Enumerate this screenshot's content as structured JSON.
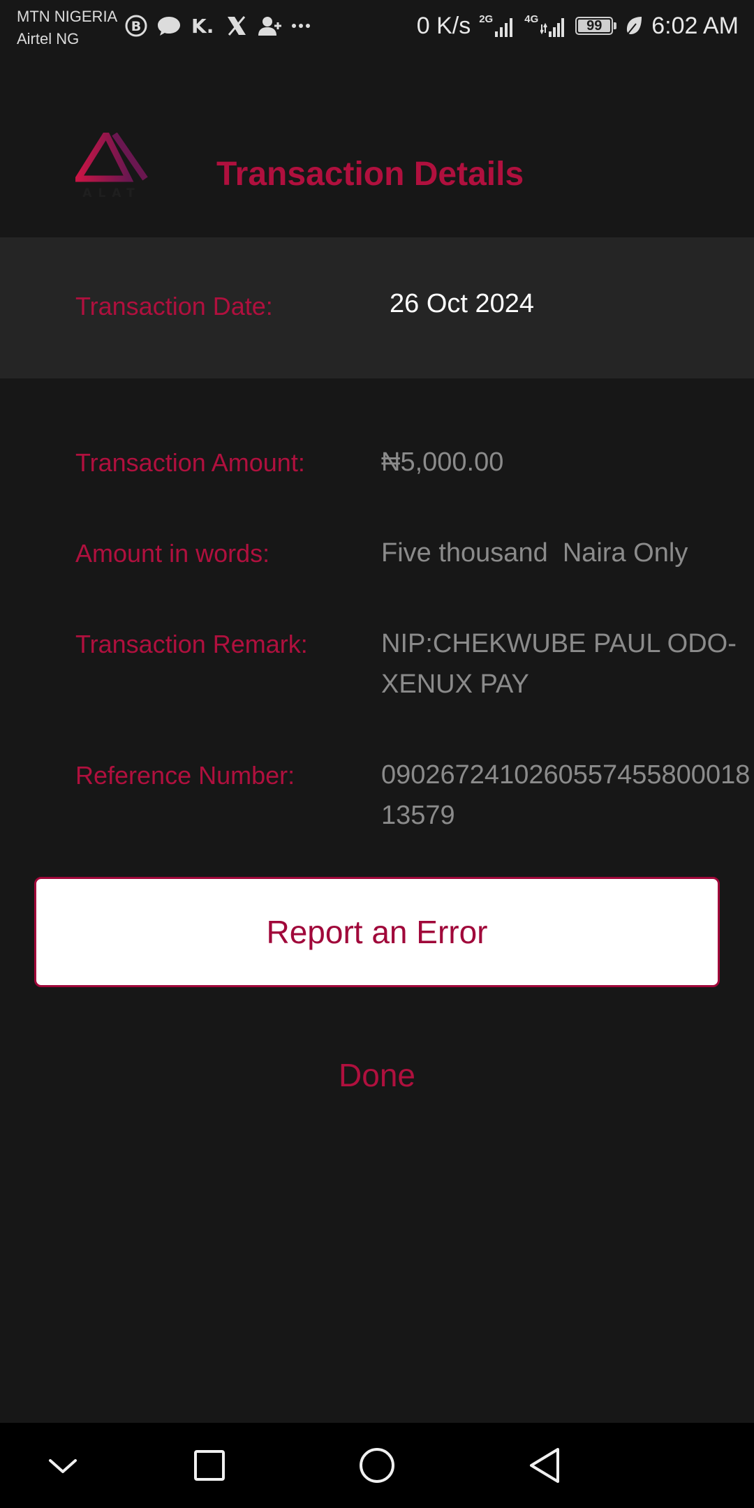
{
  "status_bar": {
    "carrier_1": "MTN NIGERIA",
    "carrier_2": "Airtel NG",
    "notification_icons": [
      "b-circle-icon",
      "chat-bubble-icon",
      "k-icon",
      "x-icon",
      "add-user-icon",
      "more-dots-icon"
    ],
    "net_speed": "0 K/s",
    "net_1": "2G",
    "net_2": "4G",
    "battery": "99",
    "battery_level": 0.99,
    "time": "6:02 AM"
  },
  "header": {
    "logo_text": "ALAT",
    "title": "Transaction Details"
  },
  "details": {
    "date_label": "Transaction Date:",
    "date_value": "26 Oct 2024",
    "amount_label": "Transaction Amount:",
    "amount_value": "₦5,000.00",
    "words_label": "Amount in words:",
    "words_value": "Five thousand  Naira Only",
    "remark_label": "Transaction Remark:",
    "remark_value": "NIP:CHEKWUBE PAUL ODO-XENUX PAY",
    "ref_label": "Reference Number:",
    "ref_value": "090267241026055745580001813579"
  },
  "actions": {
    "report_label": "Report an Error",
    "done_label": "Done"
  },
  "nav": {
    "icons": [
      "chevron-down-icon",
      "square-icon",
      "circle-icon",
      "triangle-back-icon"
    ]
  },
  "colors": {
    "accent": "#b0103e",
    "background": "#171717",
    "band": "#252525"
  }
}
